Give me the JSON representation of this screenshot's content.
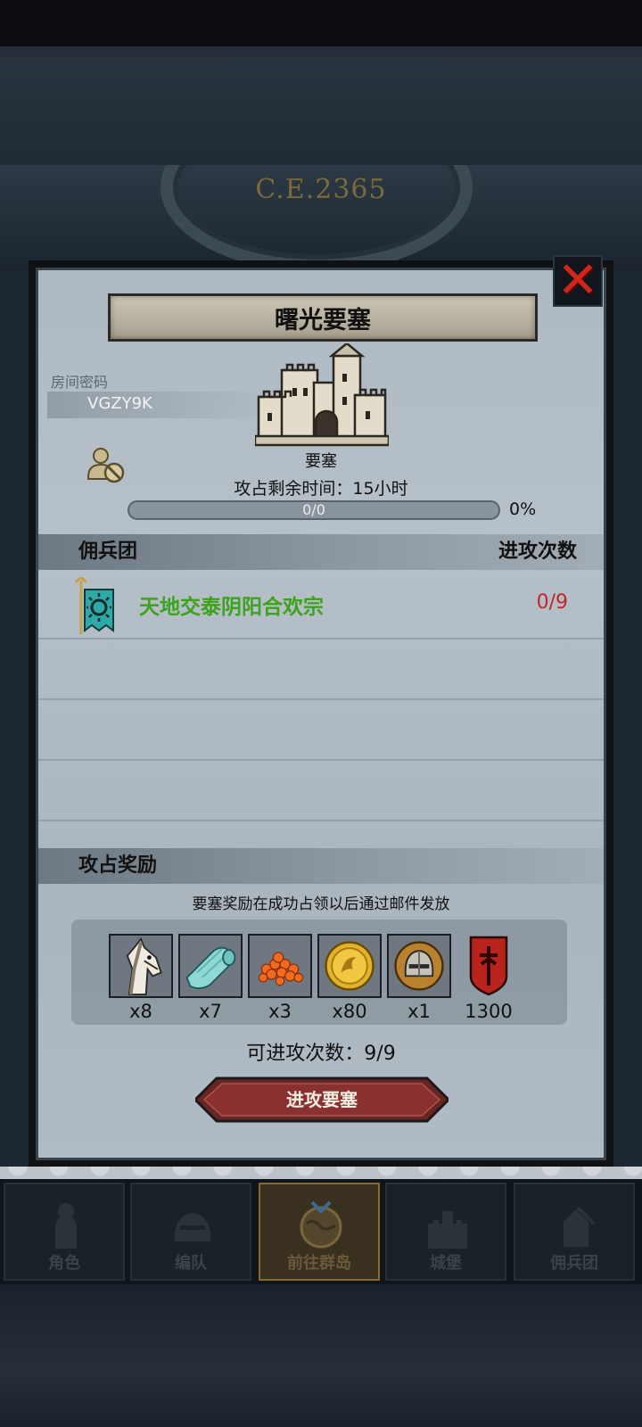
{
  "banner": {
    "era": "C.E.2365"
  },
  "dialog": {
    "title": "曙光要塞",
    "room": {
      "label": "房间密码",
      "code": "VGZY9K"
    },
    "fortress": {
      "name": "要塞",
      "remaining_time": "攻占剩余时间：15小时"
    },
    "progress": {
      "text": "0/0",
      "percent_label": "0%",
      "fraction": 0
    },
    "mercenary_section": {
      "title": "佣兵团",
      "right_label": "进攻次数"
    },
    "mercenaries": [
      {
        "name": "天地交泰阴阳合欢宗",
        "count": "0/9",
        "banner_icon": "guild-banner-icon"
      }
    ],
    "reward_section": {
      "title": "攻占奖励",
      "note": "要塞奖励在成功占领以后通过邮件发放"
    },
    "rewards": [
      {
        "icon": "horse-icon",
        "qty": "x8"
      },
      {
        "icon": "cloth-icon",
        "qty": "x7"
      },
      {
        "icon": "fish-roe-icon",
        "qty": "x3"
      },
      {
        "icon": "gold-coin-icon",
        "qty": "x80"
      },
      {
        "icon": "helmet-icon",
        "qty": "x1"
      },
      {
        "icon": "guild-shield-icon",
        "qty": "1300"
      }
    ],
    "attack_count": "可进攻次数：9/9",
    "attack_button": "进攻要塞"
  },
  "nav": [
    {
      "label": "角色",
      "icon": "knight-icon"
    },
    {
      "label": "编队",
      "icon": "helmet-team-icon"
    },
    {
      "label": "前往群岛",
      "icon": "globe-icon",
      "active": true
    },
    {
      "label": "城堡",
      "icon": "castle-icon"
    },
    {
      "label": "佣兵团",
      "icon": "mercenary-icon"
    }
  ],
  "colors": {
    "accent_green": "#3da21c",
    "accent_red": "#c0262a",
    "close_red": "#d4251c"
  }
}
